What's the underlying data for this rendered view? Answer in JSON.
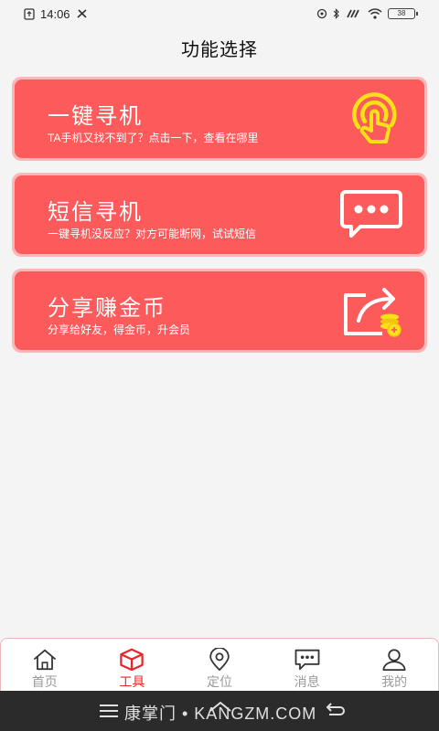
{
  "status": {
    "time": "14:06",
    "battery": "38"
  },
  "page_title": "功能选择",
  "cards": [
    {
      "title": "一键寻机",
      "subtitle": "TA手机又找不到了？点击一下，查看在哪里",
      "icon": "tap-finger-icon"
    },
    {
      "title": "短信寻机",
      "subtitle": "一键寻机没反应？对方可能断网，试试短信",
      "icon": "message-bubble-icon"
    },
    {
      "title": "分享赚金币",
      "subtitle": "分享给好友，得金币，升会员",
      "icon": "share-coins-icon"
    }
  ],
  "tabs": [
    {
      "label": "首页",
      "icon": "home-icon",
      "active": false
    },
    {
      "label": "工具",
      "icon": "cube-icon",
      "active": true
    },
    {
      "label": "定位",
      "icon": "location-pin-icon",
      "active": false
    },
    {
      "label": "消息",
      "icon": "chat-icon",
      "active": false
    },
    {
      "label": "我的",
      "icon": "person-icon",
      "active": false
    }
  ],
  "watermark": "康掌门 • KANGZM.COM",
  "colors": {
    "card_bg": "#fd5a5c",
    "card_border": "#fbb6b8",
    "active_tab": "#e8262a",
    "inactive_tab": "#9a9a9a",
    "icon_yellow": "#f7e21a"
  }
}
